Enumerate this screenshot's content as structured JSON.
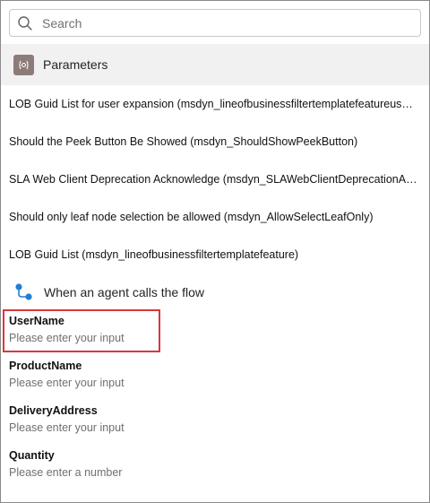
{
  "search": {
    "placeholder": "Search"
  },
  "parameters": {
    "title": "Parameters",
    "items": [
      {
        "label": "LOB Guid List for user expansion (msdyn_lineofbusinessfiltertemplatefeatureusere..."
      },
      {
        "label": "Should the Peek Button Be Showed (msdyn_ShouldShowPeekButton)"
      },
      {
        "label": "SLA Web Client Deprecation Acknowledge (msdyn_SLAWebClientDeprecationAckn..."
      },
      {
        "label": "Should only leaf node selection be allowed (msdyn_AllowSelectLeafOnly)"
      },
      {
        "label": "LOB Guid List (msdyn_lineofbusinessfiltertemplatefeature)"
      }
    ]
  },
  "trigger": {
    "title": "When an agent calls the flow",
    "fields": [
      {
        "label": "UserName",
        "placeholder": "Please enter your input"
      },
      {
        "label": "ProductName",
        "placeholder": "Please enter your input"
      },
      {
        "label": "DeliveryAddress",
        "placeholder": "Please enter your input"
      },
      {
        "label": "Quantity",
        "placeholder": "Please enter a number"
      }
    ]
  },
  "colors": {
    "highlight": "#d9363e",
    "param_icon_bg": "#8c7b78",
    "trigger_icon": "#1f7fd6",
    "section_bg": "#f2f1f1"
  },
  "icons": {
    "search": "search-icon",
    "parameters": "parameters-icon",
    "trigger": "flow-trigger-icon"
  }
}
